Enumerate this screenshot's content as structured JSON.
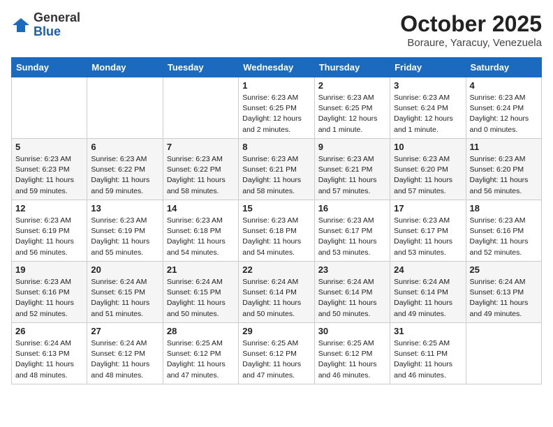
{
  "header": {
    "logo_general": "General",
    "logo_blue": "Blue",
    "month_title": "October 2025",
    "location": "Boraure, Yaracuy, Venezuela"
  },
  "days_of_week": [
    "Sunday",
    "Monday",
    "Tuesday",
    "Wednesday",
    "Thursday",
    "Friday",
    "Saturday"
  ],
  "weeks": [
    [
      {
        "day": "",
        "info": ""
      },
      {
        "day": "",
        "info": ""
      },
      {
        "day": "",
        "info": ""
      },
      {
        "day": "1",
        "info": "Sunrise: 6:23 AM\nSunset: 6:25 PM\nDaylight: 12 hours\nand 2 minutes."
      },
      {
        "day": "2",
        "info": "Sunrise: 6:23 AM\nSunset: 6:25 PM\nDaylight: 12 hours\nand 1 minute."
      },
      {
        "day": "3",
        "info": "Sunrise: 6:23 AM\nSunset: 6:24 PM\nDaylight: 12 hours\nand 1 minute."
      },
      {
        "day": "4",
        "info": "Sunrise: 6:23 AM\nSunset: 6:24 PM\nDaylight: 12 hours\nand 0 minutes."
      }
    ],
    [
      {
        "day": "5",
        "info": "Sunrise: 6:23 AM\nSunset: 6:23 PM\nDaylight: 11 hours\nand 59 minutes."
      },
      {
        "day": "6",
        "info": "Sunrise: 6:23 AM\nSunset: 6:22 PM\nDaylight: 11 hours\nand 59 minutes."
      },
      {
        "day": "7",
        "info": "Sunrise: 6:23 AM\nSunset: 6:22 PM\nDaylight: 11 hours\nand 58 minutes."
      },
      {
        "day": "8",
        "info": "Sunrise: 6:23 AM\nSunset: 6:21 PM\nDaylight: 11 hours\nand 58 minutes."
      },
      {
        "day": "9",
        "info": "Sunrise: 6:23 AM\nSunset: 6:21 PM\nDaylight: 11 hours\nand 57 minutes."
      },
      {
        "day": "10",
        "info": "Sunrise: 6:23 AM\nSunset: 6:20 PM\nDaylight: 11 hours\nand 57 minutes."
      },
      {
        "day": "11",
        "info": "Sunrise: 6:23 AM\nSunset: 6:20 PM\nDaylight: 11 hours\nand 56 minutes."
      }
    ],
    [
      {
        "day": "12",
        "info": "Sunrise: 6:23 AM\nSunset: 6:19 PM\nDaylight: 11 hours\nand 56 minutes."
      },
      {
        "day": "13",
        "info": "Sunrise: 6:23 AM\nSunset: 6:19 PM\nDaylight: 11 hours\nand 55 minutes."
      },
      {
        "day": "14",
        "info": "Sunrise: 6:23 AM\nSunset: 6:18 PM\nDaylight: 11 hours\nand 54 minutes."
      },
      {
        "day": "15",
        "info": "Sunrise: 6:23 AM\nSunset: 6:18 PM\nDaylight: 11 hours\nand 54 minutes."
      },
      {
        "day": "16",
        "info": "Sunrise: 6:23 AM\nSunset: 6:17 PM\nDaylight: 11 hours\nand 53 minutes."
      },
      {
        "day": "17",
        "info": "Sunrise: 6:23 AM\nSunset: 6:17 PM\nDaylight: 11 hours\nand 53 minutes."
      },
      {
        "day": "18",
        "info": "Sunrise: 6:23 AM\nSunset: 6:16 PM\nDaylight: 11 hours\nand 52 minutes."
      }
    ],
    [
      {
        "day": "19",
        "info": "Sunrise: 6:23 AM\nSunset: 6:16 PM\nDaylight: 11 hours\nand 52 minutes."
      },
      {
        "day": "20",
        "info": "Sunrise: 6:24 AM\nSunset: 6:15 PM\nDaylight: 11 hours\nand 51 minutes."
      },
      {
        "day": "21",
        "info": "Sunrise: 6:24 AM\nSunset: 6:15 PM\nDaylight: 11 hours\nand 50 minutes."
      },
      {
        "day": "22",
        "info": "Sunrise: 6:24 AM\nSunset: 6:14 PM\nDaylight: 11 hours\nand 50 minutes."
      },
      {
        "day": "23",
        "info": "Sunrise: 6:24 AM\nSunset: 6:14 PM\nDaylight: 11 hours\nand 50 minutes."
      },
      {
        "day": "24",
        "info": "Sunrise: 6:24 AM\nSunset: 6:14 PM\nDaylight: 11 hours\nand 49 minutes."
      },
      {
        "day": "25",
        "info": "Sunrise: 6:24 AM\nSunset: 6:13 PM\nDaylight: 11 hours\nand 49 minutes."
      }
    ],
    [
      {
        "day": "26",
        "info": "Sunrise: 6:24 AM\nSunset: 6:13 PM\nDaylight: 11 hours\nand 48 minutes."
      },
      {
        "day": "27",
        "info": "Sunrise: 6:24 AM\nSunset: 6:12 PM\nDaylight: 11 hours\nand 48 minutes."
      },
      {
        "day": "28",
        "info": "Sunrise: 6:25 AM\nSunset: 6:12 PM\nDaylight: 11 hours\nand 47 minutes."
      },
      {
        "day": "29",
        "info": "Sunrise: 6:25 AM\nSunset: 6:12 PM\nDaylight: 11 hours\nand 47 minutes."
      },
      {
        "day": "30",
        "info": "Sunrise: 6:25 AM\nSunset: 6:12 PM\nDaylight: 11 hours\nand 46 minutes."
      },
      {
        "day": "31",
        "info": "Sunrise: 6:25 AM\nSunset: 6:11 PM\nDaylight: 11 hours\nand 46 minutes."
      },
      {
        "day": "",
        "info": ""
      }
    ]
  ]
}
